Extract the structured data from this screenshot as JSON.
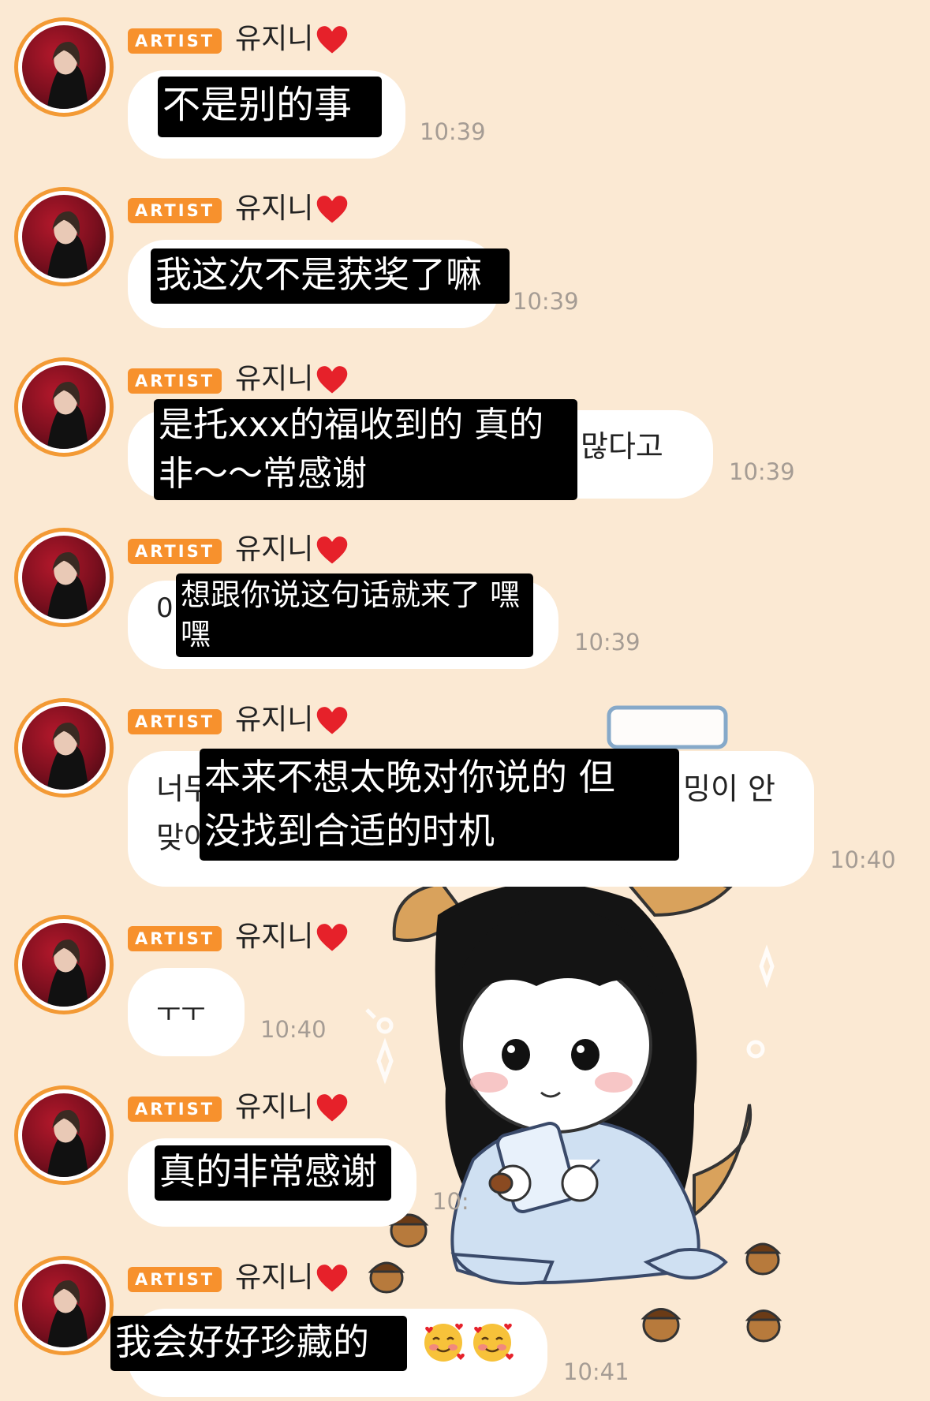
{
  "messages": [
    {
      "badge": "ARTIST",
      "sender": "유지니",
      "caption": "不是别的事",
      "time": "10:39"
    },
    {
      "badge": "ARTIST",
      "sender": "유지니",
      "caption": "我这次不是获奖了嘛",
      "time": "10:39"
    },
    {
      "badge": "ARTIST",
      "sender": "유지니",
      "caption_line1": "是托xxx的福收到的 真的",
      "caption_line2": "非～～常感谢",
      "korean_peek": "많다고",
      "time": "10:39"
    },
    {
      "badge": "ARTIST",
      "sender": "유지니",
      "caption_line1": "想跟你说这句话就来了 嘿",
      "caption_line2": "嘿",
      "korean_peek": "0",
      "time": "10:39"
    },
    {
      "badge": "ARTIST",
      "sender": "유지니",
      "caption_line1": "本来不想太晚对你说的 但",
      "caption_line2": "没找到合适的时机",
      "korean_peek_l1": "너무",
      "korean_peek_r1": "밍이 안",
      "korean_peek_l2": "맞아",
      "time": "10:40"
    },
    {
      "badge": "ARTIST",
      "sender": "유지니",
      "text": "ㅜㅜ",
      "time": "10:40"
    },
    {
      "badge": "ARTIST",
      "sender": "유지니",
      "caption": "真的非常感谢",
      "time_peek": "10:"
    },
    {
      "badge": "ARTIST",
      "sender": "유지니",
      "caption": "我会好好珍藏的",
      "emoji_names": [
        "smiling-face-with-hearts",
        "smiling-face-with-hearts"
      ],
      "time": "10:41"
    }
  ],
  "colors": {
    "background": "#fbe9d3",
    "badge": "#f7912d",
    "avatar_ring": "#f39a35",
    "bubble": "#ffffff",
    "timestamp": "#a59c94",
    "heart": "#e6212a"
  }
}
